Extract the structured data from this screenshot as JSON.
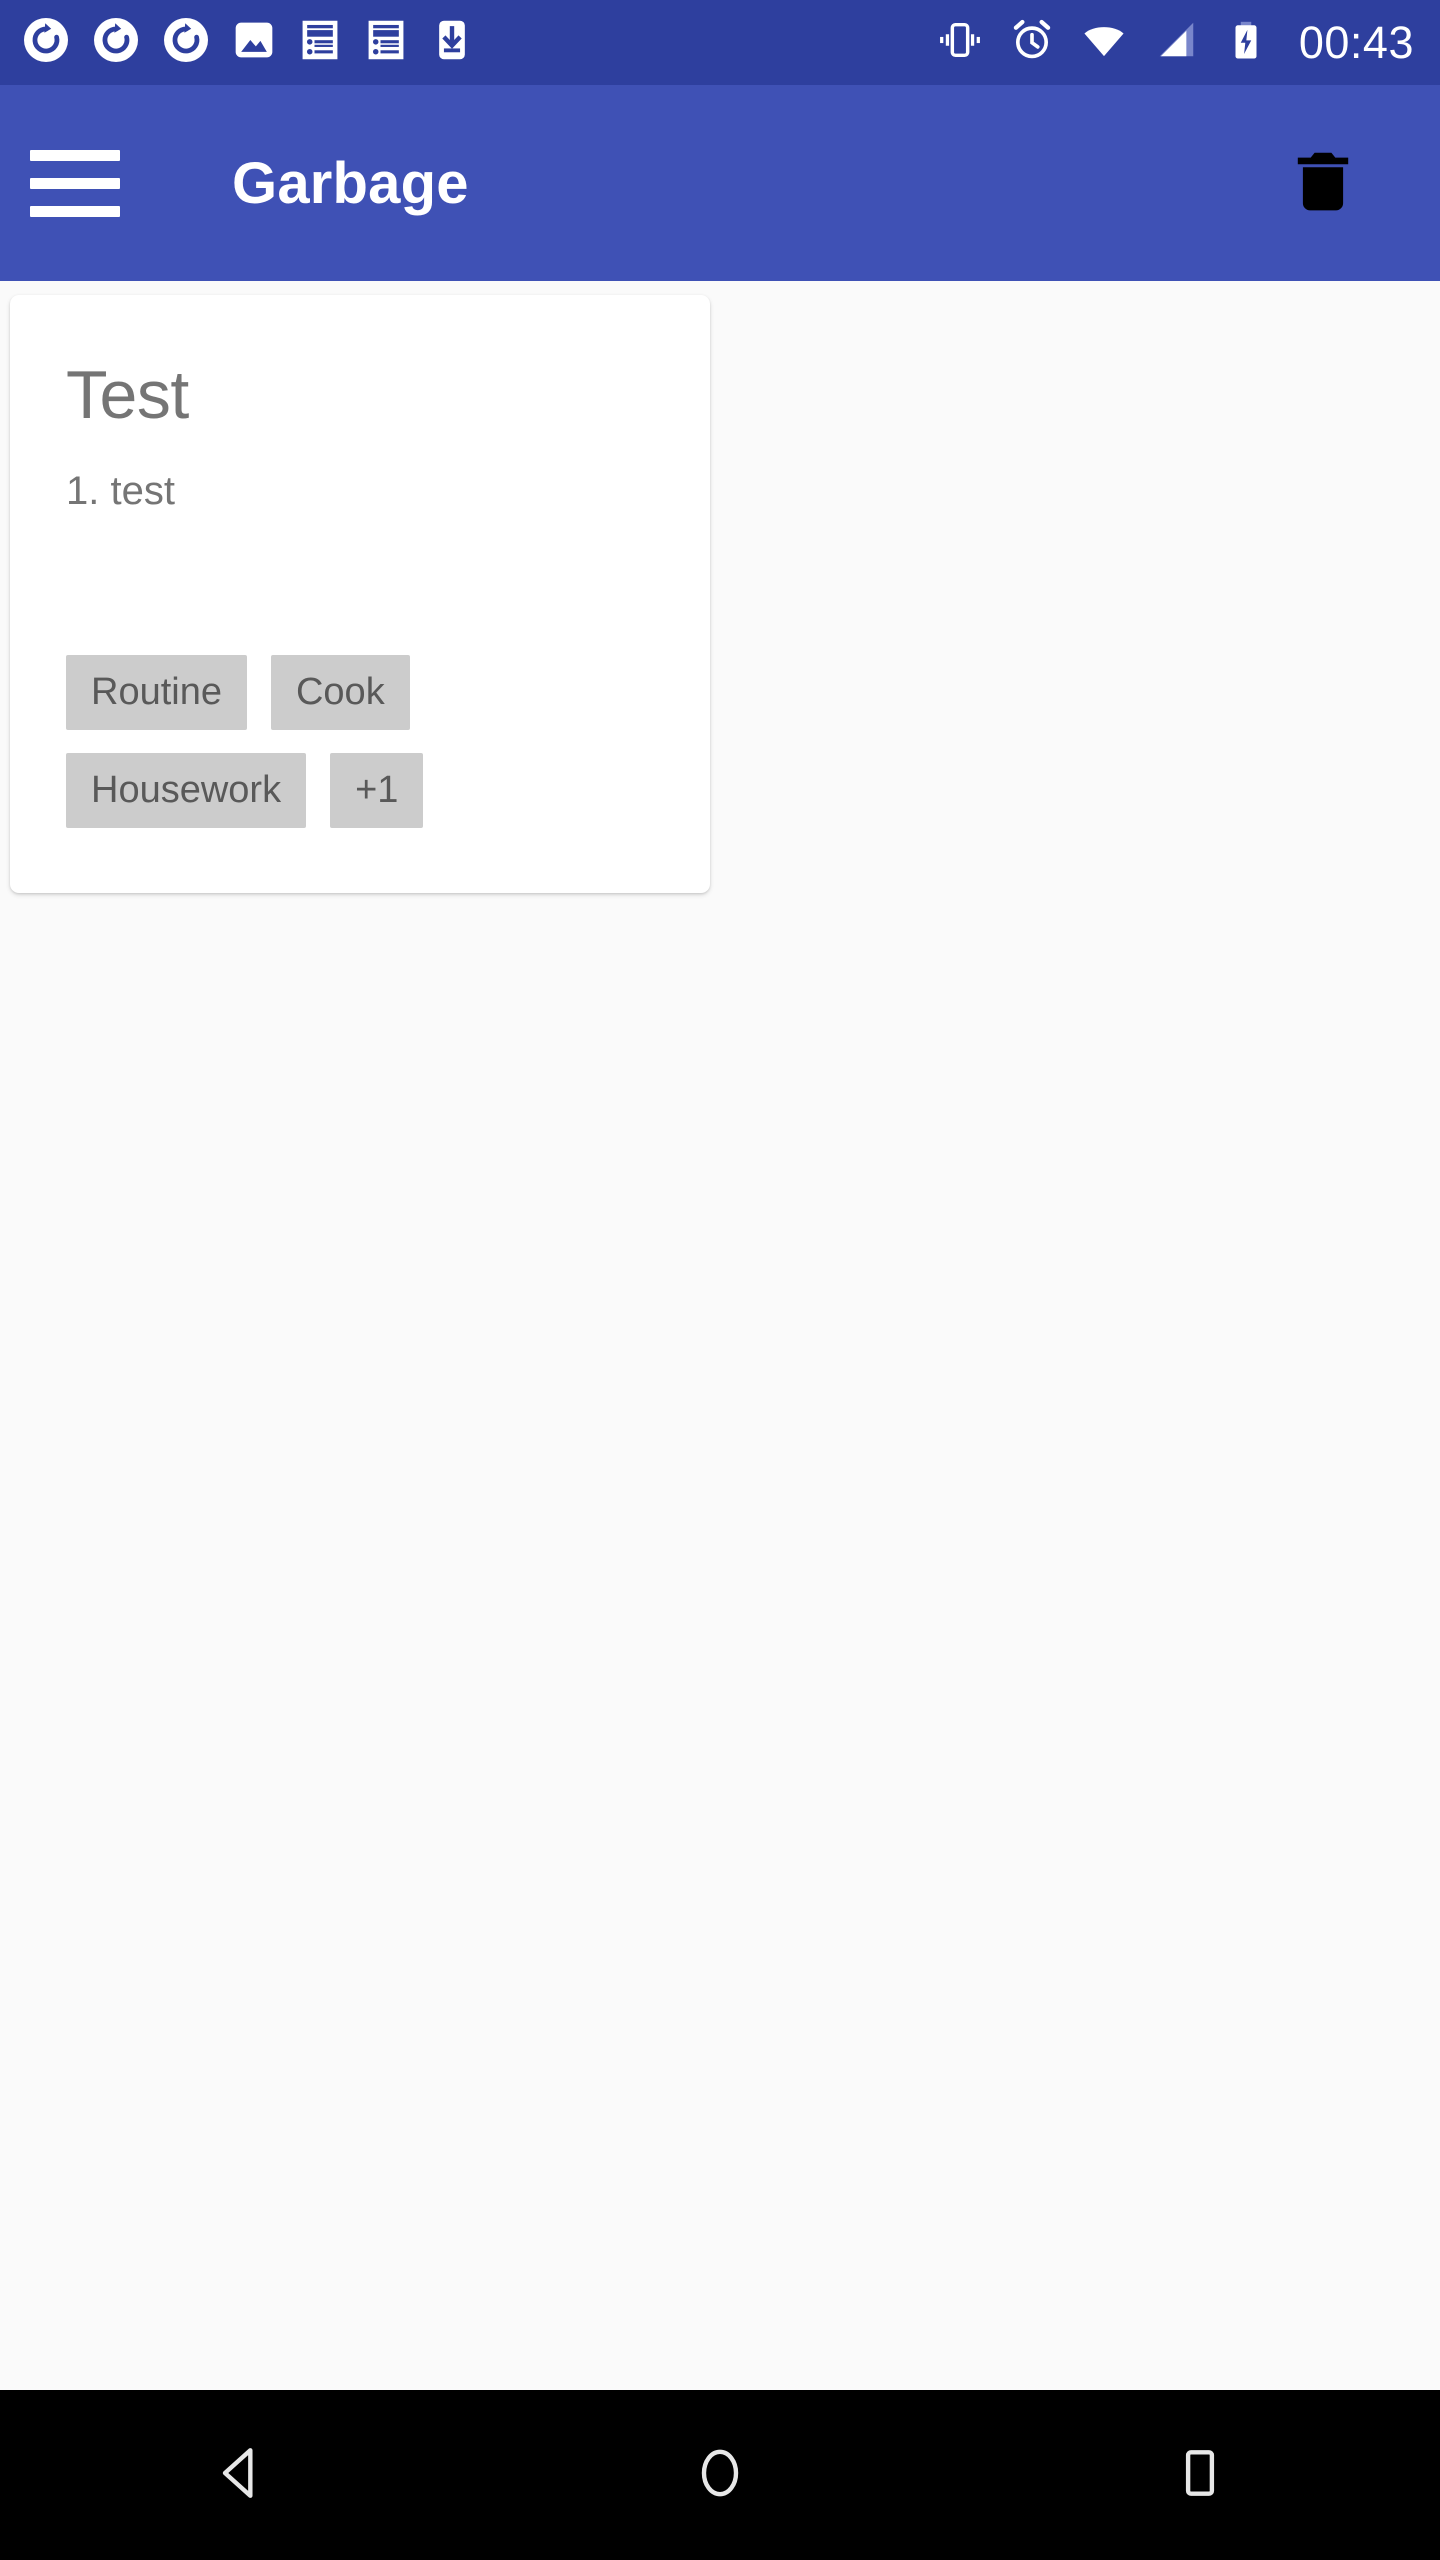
{
  "status_bar": {
    "background_color": "#2E3F9E",
    "clock": "00:43",
    "left_icons": [
      {
        "name": "sync-rotate-icon-1",
        "glyph": "rotate"
      },
      {
        "name": "sync-rotate-icon-2",
        "glyph": "rotate"
      },
      {
        "name": "sync-rotate-icon-3",
        "glyph": "rotate"
      },
      {
        "name": "image-notification-icon",
        "glyph": "image"
      },
      {
        "name": "article-notification-icon-1",
        "glyph": "article"
      },
      {
        "name": "article-notification-icon-2",
        "glyph": "article"
      },
      {
        "name": "download-to-device-icon",
        "glyph": "download"
      }
    ],
    "right_icons": [
      {
        "name": "vibrate-icon",
        "glyph": "vibrate"
      },
      {
        "name": "alarm-clock-icon",
        "glyph": "alarm"
      },
      {
        "name": "wifi-icon",
        "glyph": "wifi"
      },
      {
        "name": "cellular-signal-icon",
        "glyph": "signal"
      },
      {
        "name": "battery-charging-icon",
        "glyph": "battery-charging"
      }
    ]
  },
  "app_bar": {
    "background_color": "#3F51B5",
    "menu_label": "Menu",
    "title": "Garbage",
    "delete_label": "Delete"
  },
  "content": {
    "background_color": "#FAFAFA",
    "card": {
      "title": "Test",
      "subtitle": "1. test",
      "chip_background_color": "#CCCCCC",
      "chip_text_color": "#595959",
      "chips": [
        {
          "label": "Routine"
        },
        {
          "label": "Cook"
        },
        {
          "label": "Housework"
        },
        {
          "label": "+1"
        }
      ]
    }
  },
  "nav_bar": {
    "background_color": "#000000",
    "buttons": [
      {
        "name": "back",
        "label": "Back"
      },
      {
        "name": "home",
        "label": "Home"
      },
      {
        "name": "recents",
        "label": "Recents"
      }
    ]
  }
}
